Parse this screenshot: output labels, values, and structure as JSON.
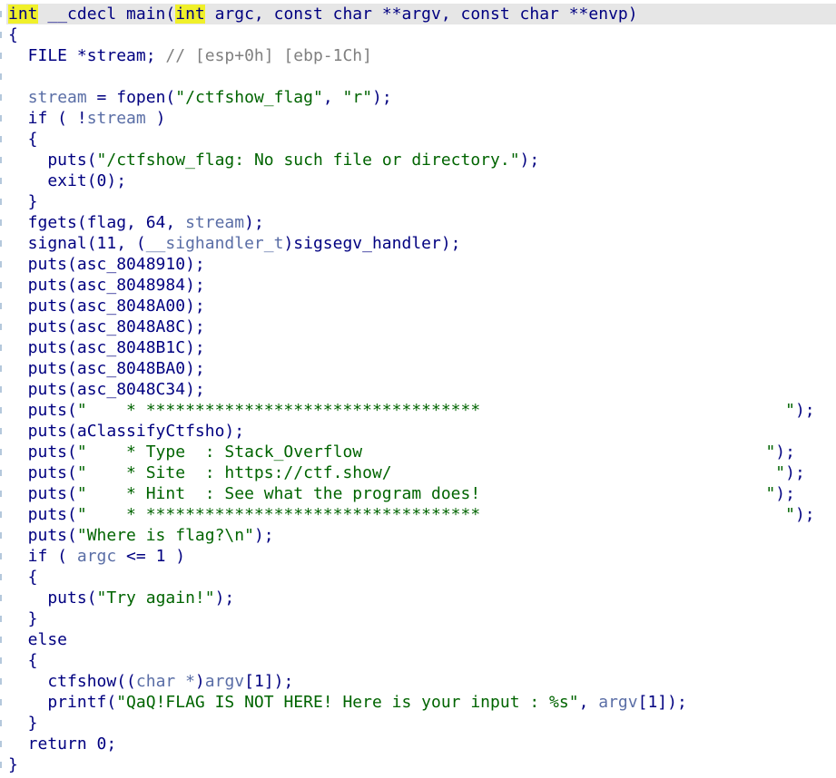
{
  "code_lines": [
    [
      {
        "t": "int",
        "c": "kw-hl"
      },
      {
        "t": " __cdecl main(",
        "c": "plain"
      },
      {
        "t": "int",
        "c": "kw-hl"
      },
      {
        "t": " argc, const char **argv, const char **envp)",
        "c": "plain"
      }
    ],
    [
      {
        "t": "{",
        "c": "plain"
      }
    ],
    [
      {
        "t": "  FILE *stream; ",
        "c": "plain"
      },
      {
        "t": "// [esp+0h] [ebp-1Ch]",
        "c": "cmt"
      }
    ],
    [],
    [
      {
        "t": "  ",
        "c": "plain"
      },
      {
        "t": "stream",
        "c": "var"
      },
      {
        "t": " = fopen(",
        "c": "plain"
      },
      {
        "t": "\"/ctfshow_flag\"",
        "c": "str"
      },
      {
        "t": ", ",
        "c": "plain"
      },
      {
        "t": "\"r\"",
        "c": "str"
      },
      {
        "t": ");",
        "c": "plain"
      }
    ],
    [
      {
        "t": "  if ( !",
        "c": "plain"
      },
      {
        "t": "stream",
        "c": "var"
      },
      {
        "t": " )",
        "c": "plain"
      }
    ],
    [
      {
        "t": "  {",
        "c": "plain"
      }
    ],
    [
      {
        "t": "    puts(",
        "c": "plain"
      },
      {
        "t": "\"/ctfshow_flag: No such file or directory.\"",
        "c": "str"
      },
      {
        "t": ");",
        "c": "plain"
      }
    ],
    [
      {
        "t": "    exit(0);",
        "c": "plain"
      }
    ],
    [
      {
        "t": "  }",
        "c": "plain"
      }
    ],
    [
      {
        "t": "  fgets(flag, 64, ",
        "c": "plain"
      },
      {
        "t": "stream",
        "c": "var"
      },
      {
        "t": ");",
        "c": "plain"
      }
    ],
    [
      {
        "t": "  signal(11, (",
        "c": "plain"
      },
      {
        "t": "__sighandler_t",
        "c": "var"
      },
      {
        "t": ")sigsegv_handler);",
        "c": "plain"
      }
    ],
    [
      {
        "t": "  puts(asc_8048910);",
        "c": "plain"
      }
    ],
    [
      {
        "t": "  puts(asc_8048984);",
        "c": "plain"
      }
    ],
    [
      {
        "t": "  puts(asc_8048A00);",
        "c": "plain"
      }
    ],
    [
      {
        "t": "  puts(asc_8048A8C);",
        "c": "plain"
      }
    ],
    [
      {
        "t": "  puts(asc_8048B1C);",
        "c": "plain"
      }
    ],
    [
      {
        "t": "  puts(asc_8048BA0);",
        "c": "plain"
      }
    ],
    [
      {
        "t": "  puts(asc_8048C34);",
        "c": "plain"
      }
    ],
    [
      {
        "t": "  puts(",
        "c": "plain"
      },
      {
        "t": "\"    * **********************************                               \"",
        "c": "str"
      },
      {
        "t": ");",
        "c": "plain"
      }
    ],
    [
      {
        "t": "  puts(aClassifyCtfsho);",
        "c": "plain"
      }
    ],
    [
      {
        "t": "  puts(",
        "c": "plain"
      },
      {
        "t": "\"    * Type  : Stack_Overflow                                         \"",
        "c": "str"
      },
      {
        "t": ");",
        "c": "plain"
      }
    ],
    [
      {
        "t": "  puts(",
        "c": "plain"
      },
      {
        "t": "\"    * Site  : https://ctf.show/                                       \"",
        "c": "str"
      },
      {
        "t": ");",
        "c": "plain"
      }
    ],
    [
      {
        "t": "  puts(",
        "c": "plain"
      },
      {
        "t": "\"    * Hint  : See what the program does!                             \"",
        "c": "str"
      },
      {
        "t": ");",
        "c": "plain"
      }
    ],
    [
      {
        "t": "  puts(",
        "c": "plain"
      },
      {
        "t": "\"    * **********************************                               \"",
        "c": "str"
      },
      {
        "t": ");",
        "c": "plain"
      }
    ],
    [
      {
        "t": "  puts(",
        "c": "plain"
      },
      {
        "t": "\"Where is flag?\\n\"",
        "c": "str"
      },
      {
        "t": ");",
        "c": "plain"
      }
    ],
    [
      {
        "t": "  if ( ",
        "c": "plain"
      },
      {
        "t": "argc",
        "c": "var"
      },
      {
        "t": " <= 1 )",
        "c": "plain"
      }
    ],
    [
      {
        "t": "  {",
        "c": "plain"
      }
    ],
    [
      {
        "t": "    puts(",
        "c": "plain"
      },
      {
        "t": "\"Try again!\"",
        "c": "str"
      },
      {
        "t": ");",
        "c": "plain"
      }
    ],
    [
      {
        "t": "  }",
        "c": "plain"
      }
    ],
    [
      {
        "t": "  else",
        "c": "plain"
      }
    ],
    [
      {
        "t": "  {",
        "c": "plain"
      }
    ],
    [
      {
        "t": "    ctfshow((",
        "c": "plain"
      },
      {
        "t": "char *",
        "c": "var"
      },
      {
        "t": ")",
        "c": "plain"
      },
      {
        "t": "argv",
        "c": "var"
      },
      {
        "t": "[1]);",
        "c": "plain"
      }
    ],
    [
      {
        "t": "    printf(",
        "c": "plain"
      },
      {
        "t": "\"QaQ!FLAG IS NOT HERE! Here is your input : %s\"",
        "c": "str"
      },
      {
        "t": ", ",
        "c": "plain"
      },
      {
        "t": "argv",
        "c": "var"
      },
      {
        "t": "[1]);",
        "c": "plain"
      }
    ],
    [
      {
        "t": "  }",
        "c": "plain"
      }
    ],
    [
      {
        "t": "  return 0;",
        "c": "plain"
      }
    ],
    [
      {
        "t": "}",
        "c": "plain"
      }
    ]
  ],
  "colors": {
    "highlight": "#f0f02a",
    "current_line": "#e6e6e6",
    "code": "#000080",
    "variable": "#5a6ea6",
    "string": "#006400",
    "comment": "#808080"
  }
}
